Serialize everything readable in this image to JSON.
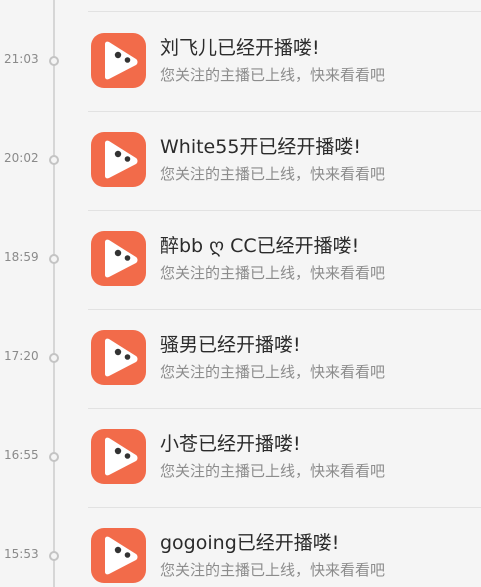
{
  "notifications": [
    {
      "time": "21:03",
      "title": "刘飞儿已经开播喽!",
      "message": "您关注的主播已上线，快来看看吧",
      "icon": "video-player-icon"
    },
    {
      "time": "20:02",
      "title": "White55开已经开播喽!",
      "message": "您关注的主播已上线，快来看看吧",
      "icon": "video-player-icon"
    },
    {
      "time": "18:59",
      "title": "醉bb ღ CC已经开播喽!",
      "message": "您关注的主播已上线，快来看看吧",
      "icon": "video-player-icon"
    },
    {
      "time": "17:20",
      "title": "骚男已经开播喽!",
      "message": "您关注的主播已上线，快来看看吧",
      "icon": "video-player-icon"
    },
    {
      "time": "16:55",
      "title": "小苍已经开播喽!",
      "message": "您关注的主播已上线，快来看看吧",
      "icon": "video-player-icon"
    },
    {
      "time": "15:53",
      "title": "gogoing已经开播喽!",
      "message": "您关注的主播已上线，快来看看吧",
      "icon": "video-player-icon"
    }
  ],
  "colors": {
    "icon_background": "#f26b4a",
    "icon_foreground": "#ffffff",
    "background": "#f5f5f5",
    "title_text": "#2b2b2b",
    "message_text": "#8c8c8c",
    "time_text": "#8a8a8a"
  }
}
